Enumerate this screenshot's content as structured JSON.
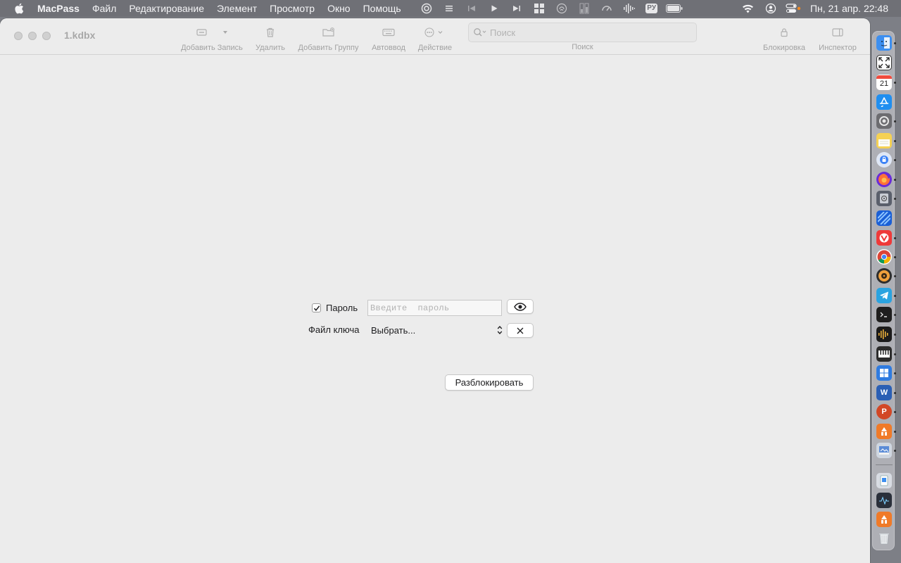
{
  "menubar": {
    "app_name": "MacPass",
    "items": [
      "Файл",
      "Редактирование",
      "Элемент",
      "Просмотр",
      "Окно",
      "Помощь"
    ],
    "input_source": "РУ",
    "clock": "Пн, 21 апр.  22:48"
  },
  "window": {
    "title": "1.kdbx",
    "toolbar": {
      "add_entry": "Добавить Запись",
      "delete": "Удалить",
      "add_group": "Добавить Группу",
      "autotype": "Автоввод",
      "action": "Действие",
      "search_placeholder": "Поиск",
      "search_label": "Поиск",
      "lock": "Блокировка",
      "inspector": "Инспектор"
    }
  },
  "unlock": {
    "password_label": "Пароль",
    "password_checked": true,
    "password_placeholder": "Введите  пароль",
    "keyfile_label": "Файл ключа",
    "keyfile_value": "Выбрать...",
    "unlock_button": "Разблокировать"
  },
  "dock": {
    "calendar_day": "21",
    "colors": {
      "finder": "#3d8ff0",
      "appstore": "#1f8ef0",
      "notes": "#f5d153",
      "firefox": "#ff7139",
      "vivaldi": "#ef3939",
      "telegram": "#2aa3e0",
      "word": "#2b5fb4",
      "powerpoint": "#d24726"
    }
  }
}
